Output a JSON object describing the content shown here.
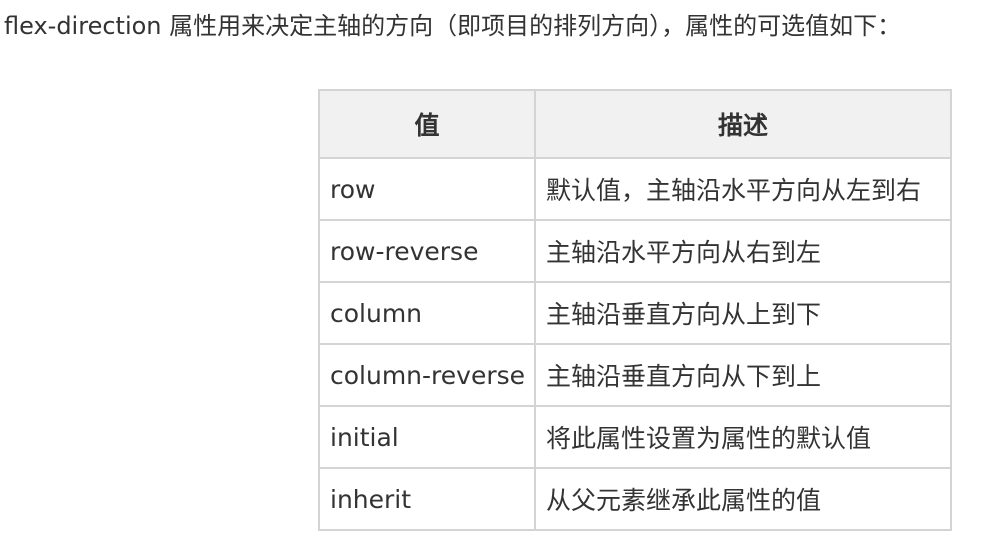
{
  "intro_text": "flex-direction 属性用来决定主轴的方向（即项目的排列方向），属性的可选值如下：",
  "table": {
    "headers": [
      "值",
      "描述"
    ],
    "rows": [
      [
        "row",
        "默认值，主轴沿水平方向从左到右"
      ],
      [
        "row-reverse",
        "主轴沿水平方向从右到左"
      ],
      [
        "column",
        "主轴沿垂直方向从上到下"
      ],
      [
        "column-reverse",
        "主轴沿垂直方向从下到上"
      ],
      [
        "initial",
        "将此属性设置为属性的默认值"
      ],
      [
        "inherit",
        "从父元素继承此属性的值"
      ]
    ]
  },
  "colors": {
    "text": "#333333",
    "header_bg": "#f1f1f1",
    "border": "#d4d4d4"
  }
}
